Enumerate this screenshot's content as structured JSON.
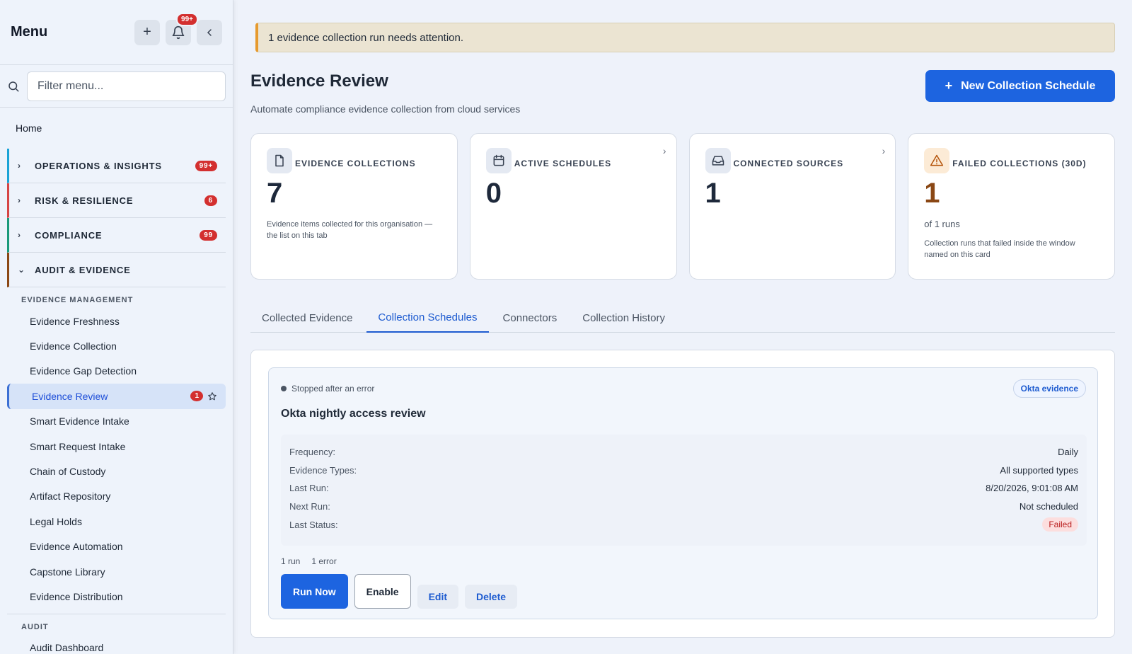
{
  "sidebar": {
    "title": "Menu",
    "notif_badge": "99+",
    "search_placeholder": "Filter menu...",
    "home": "Home",
    "groups": [
      {
        "label": "OPERATIONS & INSIGHTS",
        "badge": "99+",
        "color": "#1aa3d6"
      },
      {
        "label": "RISK & RESILIENCE",
        "badge": "6",
        "color": "#d64545"
      },
      {
        "label": "COMPLIANCE",
        "badge": "99",
        "color": "#1a9a7a"
      },
      {
        "label": "AUDIT & EVIDENCE",
        "badge": "",
        "color": "#8a4714"
      }
    ],
    "section_evidence": "EVIDENCE MANAGEMENT",
    "items": [
      "Evidence Freshness",
      "Evidence Collection",
      "Evidence Gap Detection",
      "Evidence Review",
      "Smart Evidence Intake",
      "Smart Request Intake",
      "Chain of Custody",
      "Artifact Repository",
      "Legal Holds",
      "Evidence Automation",
      "Capstone Library",
      "Evidence Distribution"
    ],
    "active_badge": "1",
    "section_audit": "AUDIT",
    "audit_items": [
      "Audit Dashboard"
    ]
  },
  "alert": "1 evidence collection run needs attention.",
  "page": {
    "title": "Evidence Review",
    "subtitle": "Automate compliance evidence collection from cloud services",
    "new_button": "New Collection Schedule"
  },
  "cards": [
    {
      "label": "EVIDENCE COLLECTIONS",
      "value": "7",
      "desc": "Evidence items collected for this organisation — the list on this tab",
      "icon": "document-icon"
    },
    {
      "label": "ACTIVE SCHEDULES",
      "value": "0",
      "icon": "calendar-icon"
    },
    {
      "label": "CONNECTED SOURCES",
      "value": "1",
      "icon": "inbox-icon"
    },
    {
      "label": "FAILED COLLECTIONS (30D)",
      "value": "1",
      "of": "of 1 runs",
      "desc": "Collection runs that failed inside the window named on this card",
      "icon": "warning-icon"
    }
  ],
  "tabs": [
    "Collected Evidence",
    "Collection Schedules",
    "Connectors",
    "Collection History"
  ],
  "schedule": {
    "status": "Stopped after an error",
    "badge": "Okta evidence",
    "title": "Okta nightly access review",
    "details": [
      {
        "key": "Frequency:",
        "value": "Daily"
      },
      {
        "key": "Evidence Types:",
        "value": "All supported types"
      },
      {
        "key": "Last Run:",
        "value": "8/20/2026, 9:01:08 AM"
      },
      {
        "key": "Next Run:",
        "value": "Not scheduled"
      },
      {
        "key": "Last Status:",
        "value": "Failed"
      }
    ],
    "runs": "1 run",
    "errors": "1 error",
    "actions": {
      "run": "Run Now",
      "enable": "Enable",
      "edit": "Edit",
      "delete": "Delete"
    }
  }
}
